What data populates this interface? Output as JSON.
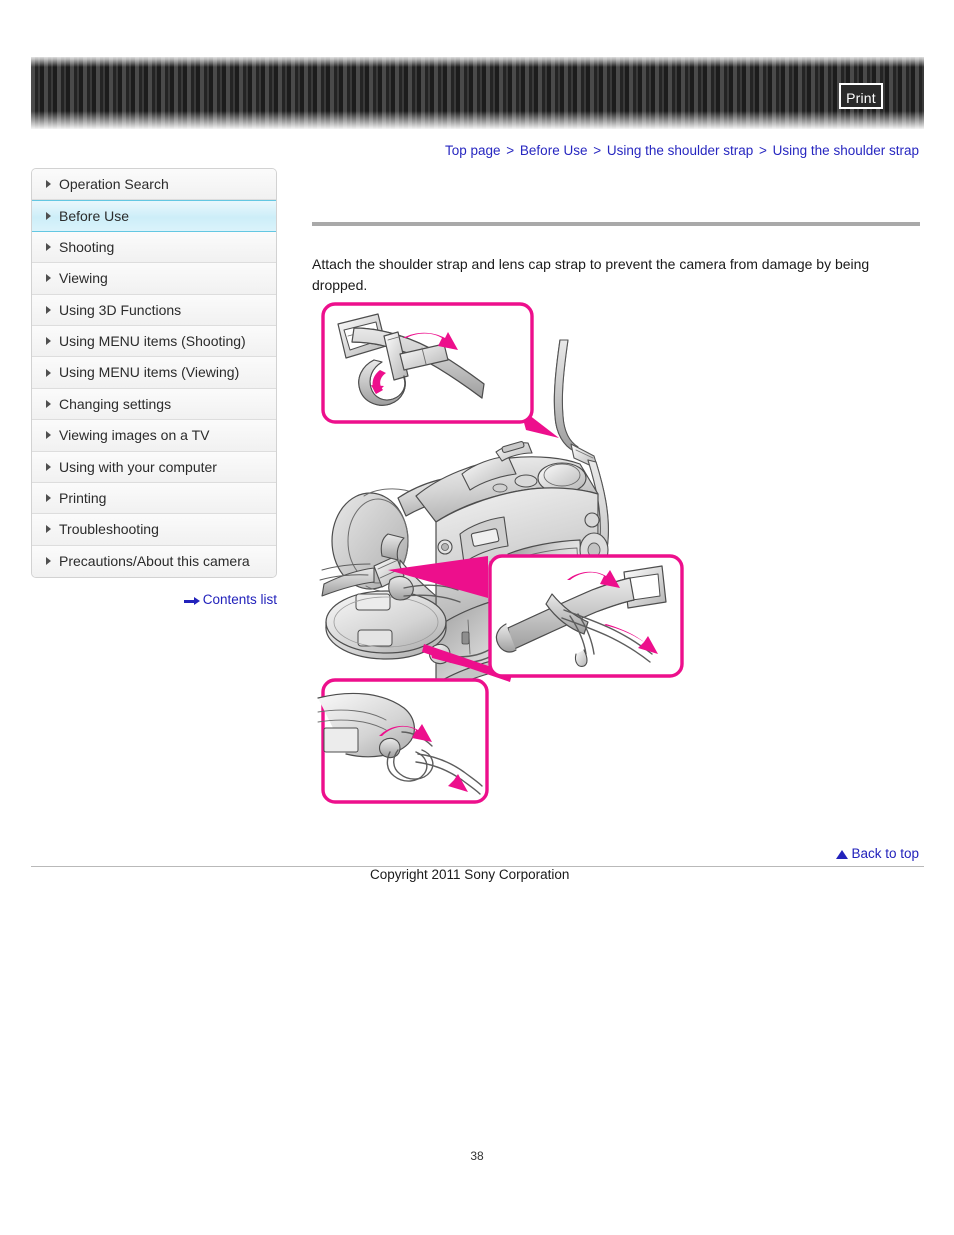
{
  "header": {
    "print_label": "Print",
    "print_icon": "printer-icon"
  },
  "breadcrumb": {
    "separator": ">",
    "items": [
      {
        "label": "Top page"
      },
      {
        "label": "Before Use"
      },
      {
        "label": "Using the shoulder strap"
      },
      {
        "label": "Using the shoulder strap"
      }
    ]
  },
  "sidebar": {
    "items": [
      {
        "label": "Operation Search",
        "active": false
      },
      {
        "label": "Before Use",
        "active": true
      },
      {
        "label": "Shooting",
        "active": false
      },
      {
        "label": "Viewing",
        "active": false
      },
      {
        "label": "Using 3D Functions",
        "active": false
      },
      {
        "label": "Using MENU items (Shooting)",
        "active": false
      },
      {
        "label": "Using MENU items (Viewing)",
        "active": false
      },
      {
        "label": "Changing settings",
        "active": false
      },
      {
        "label": "Viewing images on a TV",
        "active": false
      },
      {
        "label": "Using with your computer",
        "active": false
      },
      {
        "label": "Printing",
        "active": false
      },
      {
        "label": "Troubleshooting",
        "active": false
      },
      {
        "label": "Precautions/About this camera",
        "active": false
      }
    ],
    "contents_list_label": "Contents list",
    "contents_list_icon": "arrow-right-icon"
  },
  "main": {
    "intro_text": "Attach the shoulder strap and lens cap strap to prevent the camera from damage by being dropped.",
    "illustration_alt": "Diagram showing how to attach the shoulder strap and lens cap strap to the camera"
  },
  "footer": {
    "back_to_top_label": "Back to top",
    "back_to_top_icon": "triangle-up-icon",
    "copyright": "Copyright 2011 Sony Corporation",
    "page_number": "38"
  },
  "colors": {
    "link": "#2222bb",
    "accent_pink": "#ED0F8C",
    "active_nav": "#cdeef8",
    "rule_gray": "#a9a9a9"
  }
}
